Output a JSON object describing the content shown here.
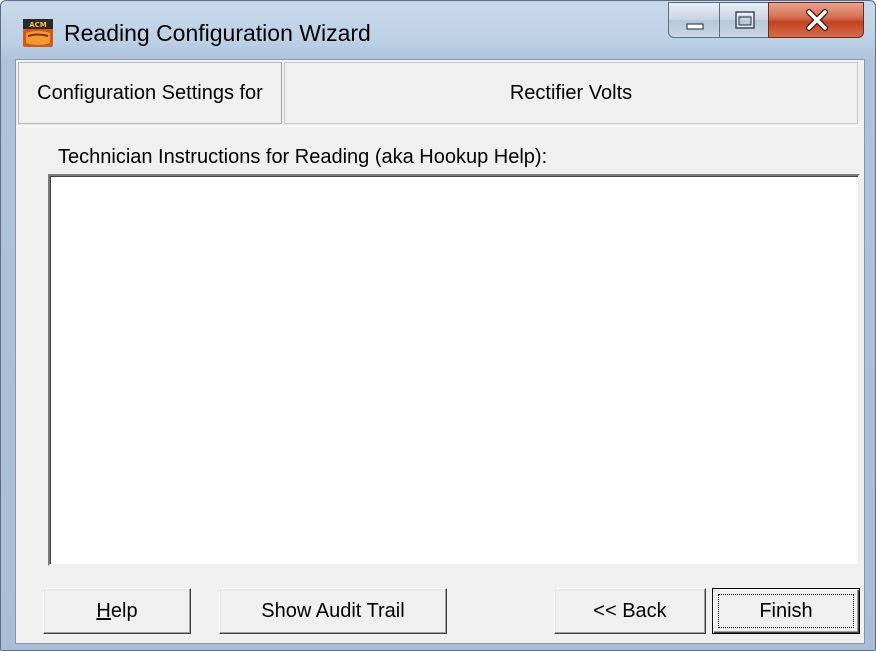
{
  "window": {
    "title": "Reading Configuration Wizard",
    "app_icon": "acm-app-icon"
  },
  "caption_buttons": {
    "minimize_icon": "minimize-icon",
    "maximize_icon": "maximize-icon",
    "close_icon": "close-icon"
  },
  "header": {
    "label": "Configuration Settings for",
    "value": "Rectifier Volts"
  },
  "instructions": {
    "label": "Technician Instructions for Reading (aka Hookup Help):",
    "value": ""
  },
  "buttons": {
    "help_prefix": "H",
    "help_rest": "elp",
    "audit": "Show Audit Trail",
    "back": "<< Back",
    "finish": "Finish"
  },
  "colors": {
    "titlebar": "#bcd0e6",
    "close_button": "#c0431f",
    "client_bg": "#f0f0f0"
  }
}
